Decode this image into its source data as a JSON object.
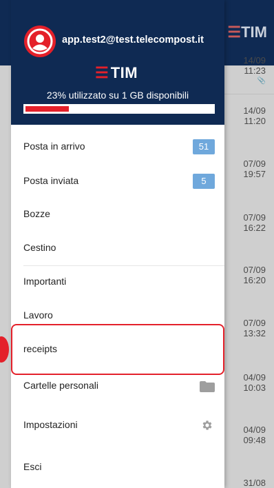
{
  "background": {
    "logo_bars": "☰",
    "logo_text": "TIM",
    "rows": [
      {
        "date": "14/09",
        "time": "11:23",
        "attachment": "📎"
      },
      {
        "date": "14/09",
        "time": "11:20"
      },
      {
        "date": "07/09",
        "time": "19:57"
      },
      {
        "date": "07/09",
        "time": "16:22"
      },
      {
        "date": "07/09",
        "time": "16:20"
      },
      {
        "date": "07/09",
        "time": "13:32"
      },
      {
        "date": "04/09",
        "time": "10:03"
      },
      {
        "date": "04/09",
        "time": "09:48"
      },
      {
        "date": "31/08",
        "time": ""
      }
    ]
  },
  "drawer": {
    "email": "app.test2@test.telecompost.it",
    "brand_bars": "☰",
    "brand": "TIM",
    "quota_text": "23% utilizzato su 1 GB disponibili",
    "quota_percent": 23,
    "items": [
      {
        "label": "Posta in arrivo",
        "badge": "51"
      },
      {
        "label": "Posta inviata",
        "badge": "5"
      },
      {
        "label": "Bozze"
      },
      {
        "label": "Cestino"
      },
      {
        "label": "Importanti"
      },
      {
        "label": "Lavoro"
      },
      {
        "label": "receipts"
      },
      {
        "label": "Cartelle personali",
        "icon": "folder-icon"
      },
      {
        "label": "Impostazioni",
        "icon": "gear-icon"
      },
      {
        "label": "Esci"
      }
    ]
  },
  "colors": {
    "header": "#0f2a53",
    "accent_red": "#e4202a",
    "badge_blue": "#6fa8dc"
  }
}
